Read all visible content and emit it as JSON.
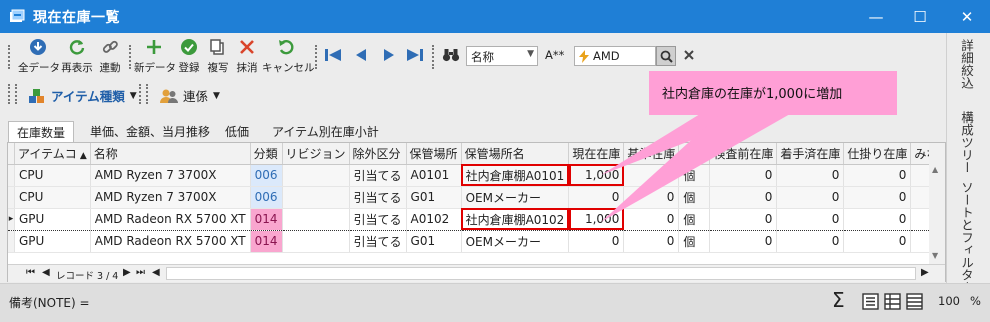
{
  "window": {
    "title": "現在在庫一覧",
    "minimize_glyph": "—",
    "maximize_glyph": "☐",
    "close_glyph": "✕"
  },
  "toolbar": {
    "buttons": [
      {
        "label": "全データ",
        "icon": "download-circle-icon"
      },
      {
        "label": "再表示",
        "icon": "refresh-icon"
      },
      {
        "label": "連動",
        "icon": "link-icon"
      },
      {
        "label": "新データ",
        "icon": "plus-icon"
      },
      {
        "label": "登録",
        "icon": "check-circle-icon"
      },
      {
        "label": "複写",
        "icon": "copy-icon"
      },
      {
        "label": "抹消",
        "icon": "delete-x-icon"
      },
      {
        "label": "キャンセル",
        "icon": "undo-icon"
      }
    ],
    "search": {
      "field": "名称",
      "match_mode": "A**",
      "value": "AMD"
    }
  },
  "ribbon2": {
    "item_type": "アイテム種類",
    "link": "連係"
  },
  "tabs": [
    "在庫数量",
    "単価、金額、当月推移",
    "低価",
    "アイテム別在庫小計"
  ],
  "active_tab": 0,
  "grid": {
    "columns": [
      "アイテムコ",
      "名称",
      "分類",
      "リビジョン",
      "除外区分",
      "保管場所",
      "保管場所名",
      "現在在庫",
      "基準在庫",
      "単位",
      "検査前在庫",
      "着手済在庫",
      "仕掛り在庫",
      "みなし"
    ],
    "sort_indicator": "▲",
    "rows": [
      [
        "CPU",
        "AMD Ryzen 7 3700X",
        "006",
        "",
        "引当てる",
        "A0101",
        "社内倉庫棚A0101",
        "1,000",
        "0",
        "個",
        "0",
        "0",
        "0",
        ""
      ],
      [
        "CPU",
        "AMD Ryzen 7 3700X",
        "006",
        "",
        "引当てる",
        "G01",
        "OEMメーカー",
        "0",
        "0",
        "個",
        "0",
        "0",
        "0",
        ""
      ],
      [
        "GPU",
        "AMD Radeon RX 5700 XT",
        "014",
        "",
        "引当てる",
        "A0102",
        "社内倉庫棚A0102",
        "1,000",
        "0",
        "個",
        "0",
        "0",
        "0",
        ""
      ],
      [
        "GPU",
        "AMD Radeon RX 5700 XT",
        "014",
        "",
        "引当てる",
        "G01",
        "OEMメーカー",
        "0",
        "0",
        "個",
        "0",
        "0",
        "0",
        ""
      ]
    ],
    "current_row_marker": "▸",
    "category_colors": {
      "006": "#dbe9fb",
      "014": "#f9a6cf"
    }
  },
  "navigator": {
    "record_text": "レコード 3 / 4"
  },
  "callout": {
    "text": "社内倉庫の在庫が1,000に増加",
    "color": "#ff9fd6"
  },
  "statusbar": {
    "note_label": "備考(NOTE) =",
    "sigma": "Σ",
    "zoom": "100",
    "zoom_unit": "%"
  },
  "right_panel": {
    "tabs": [
      "詳細絞込",
      "構成ツリー",
      "ソートとフィルター"
    ]
  },
  "colors": {
    "title_bar": "#1f7fd6",
    "highlight_border": "#e00000",
    "toolbar_icon_blue": "#2f6db5",
    "toolbar_icon_green": "#3c9a3c",
    "toolbar_icon_red": "#d9452b"
  }
}
